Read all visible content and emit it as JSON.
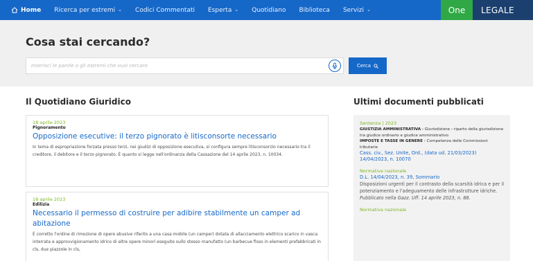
{
  "nav": {
    "items": [
      {
        "label": "Home",
        "has_dropdown": false,
        "icon": "home-icon"
      },
      {
        "label": "Ricerca per estremi",
        "has_dropdown": true
      },
      {
        "label": "Codici Commentati",
        "has_dropdown": false
      },
      {
        "label": "Esperta",
        "has_dropdown": true
      },
      {
        "label": "Quotidiano",
        "has_dropdown": false
      },
      {
        "label": "Biblioteca",
        "has_dropdown": false
      },
      {
        "label": "Servizi",
        "has_dropdown": true
      }
    ],
    "brand_one": "One",
    "brand_legale": "LEGALE"
  },
  "search": {
    "title": "Cosa stai cercando?",
    "placeholder": "Inserisci le parole o gli estremi che vuoi cercare",
    "value": "",
    "button_label": "Cerca"
  },
  "quotidiano": {
    "title": "Il Quotidiano Giuridico",
    "articles": [
      {
        "date": "18 aprile 2023",
        "category": "Pignoramento",
        "title": "Opposizione esecutive: il terzo pignorato è litisconsorte necessario",
        "text": "In tema di espropriazione forzata presso terzi, nei giudizi di opposizione esecutiva, si configura sempre litisconsorzio necessario tra il creditore, il debitore e il terzo pignorato. È quanto si legge nell'ordinanza della Cassazione del 14 aprile 2023, n. 10034."
      },
      {
        "date": "18 aprile 2023",
        "category": "Edilizia",
        "title": "Necessario il permesso di costruire per adibire stabilmente un camper ad abitazione",
        "text": "È corretto l'ordine di rimozione di opere abusive riferito a una casa mobile (un camper) dotata di allacciamento elettrico scarico in vasca interrata e approvvigionamento idrico di altre opere minori eseguite sullo stesso manufatto (un barbecue fisso in elementi prefabbricati in cls, due piazzole in cls,"
      }
    ]
  },
  "ultimi": {
    "title": "Ultimi documenti pubblicati",
    "docs": [
      {
        "kicker": "Sentenza | 2023",
        "subject1_head": "GIUSTIZIA AMMINISTRATIVA",
        "subject1_rest": "Giurisdizione › riparto della giurisdizione tra giudice ordinario e giudice amministrativo",
        "subject2_head": "IMPOSTE E TASSE IN GENERE",
        "subject2_rest": "Competenza delle Commissioni tributarie",
        "link": "Cass. civ., Sez. Unite, Ord., (data ud. 21/03/2023) 14/04/2023, n. 10070"
      },
      {
        "kicker": "Normativa nazionale",
        "link": "D.L. 14/04/2023, n. 39, Sommario",
        "desc": "Disposizioni urgenti per il contrasto della scarsità idrica e per il potenziamento e l'adeguamento delle infrastrutture idriche.",
        "pub": "Pubblicato nella Gazz. Uff. 14 aprile 2023, n. 88."
      },
      {
        "kicker": "Normativa nazionale"
      }
    ]
  },
  "colors": {
    "nav_blue": "#1668c8",
    "brand_green": "#2fa845",
    "brand_navy": "#1b3f6e",
    "date_green": "#7ab51d"
  }
}
